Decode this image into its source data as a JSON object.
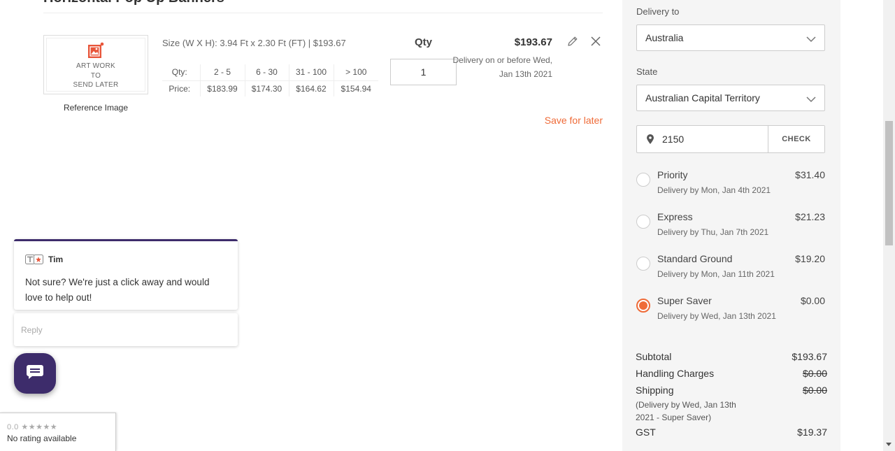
{
  "product": {
    "heading": "Horizontal Pop Up Banners",
    "size_line": "Size (W X H): 3.94 Ft x 2.30 Ft (FT) | $193.67",
    "artwork_placeholder": "ART WORK\nTO\nSEND LATER",
    "reference_caption": "Reference Image",
    "pricing": {
      "qty_label": "Qty:",
      "price_label": "Price:",
      "tiers": [
        "2 - 5",
        "6 - 30",
        "31 - 100",
        "> 100"
      ],
      "prices": [
        "$183.99",
        "$174.30",
        "$164.62",
        "$154.94"
      ]
    },
    "qty_header": "Qty",
    "qty_value": "1",
    "line_total": "$193.67",
    "delivery_note": "Delivery on or before Wed, Jan 13th 2021",
    "save_for_later": "Save for later"
  },
  "chat": {
    "agent_name": "Tim",
    "message": "Not sure? We're just a click away and would love to help out!",
    "reply_placeholder": "Reply"
  },
  "rating": {
    "score": "0.0",
    "stars": "★★★★★",
    "text": "No rating available"
  },
  "shipping": {
    "delivery_to_label": "Delivery to",
    "country": "Australia",
    "state_label": "State",
    "state": "Australian Capital Territory",
    "zip": "2150",
    "check_label": "CHECK",
    "options": [
      {
        "name": "Priority",
        "price": "$31.40",
        "date": "Delivery by Mon, Jan 4th 2021",
        "selected": false
      },
      {
        "name": "Express",
        "price": "$21.23",
        "date": "Delivery by Thu, Jan 7th 2021",
        "selected": false
      },
      {
        "name": "Standard Ground",
        "price": "$19.20",
        "date": "Delivery by Mon, Jan 11th 2021",
        "selected": false
      },
      {
        "name": "Super Saver",
        "price": "$0.00",
        "date": "Delivery by Wed, Jan 13th 2021",
        "selected": true
      }
    ]
  },
  "summary": {
    "subtotal_label": "Subtotal",
    "subtotal": "$193.67",
    "handling_label": "Handling Charges",
    "handling": "$0.00",
    "shipping_label": "Shipping",
    "shipping": "$0.00",
    "shipping_note": "(Delivery by Wed, Jan 13th 2021 - Super Saver)",
    "gst_label": "GST",
    "gst": "$19.37"
  },
  "colors": {
    "accent": "#ef6b38",
    "chat_brand": "#3d2c6b",
    "panel_bg": "#f5f5f5"
  }
}
